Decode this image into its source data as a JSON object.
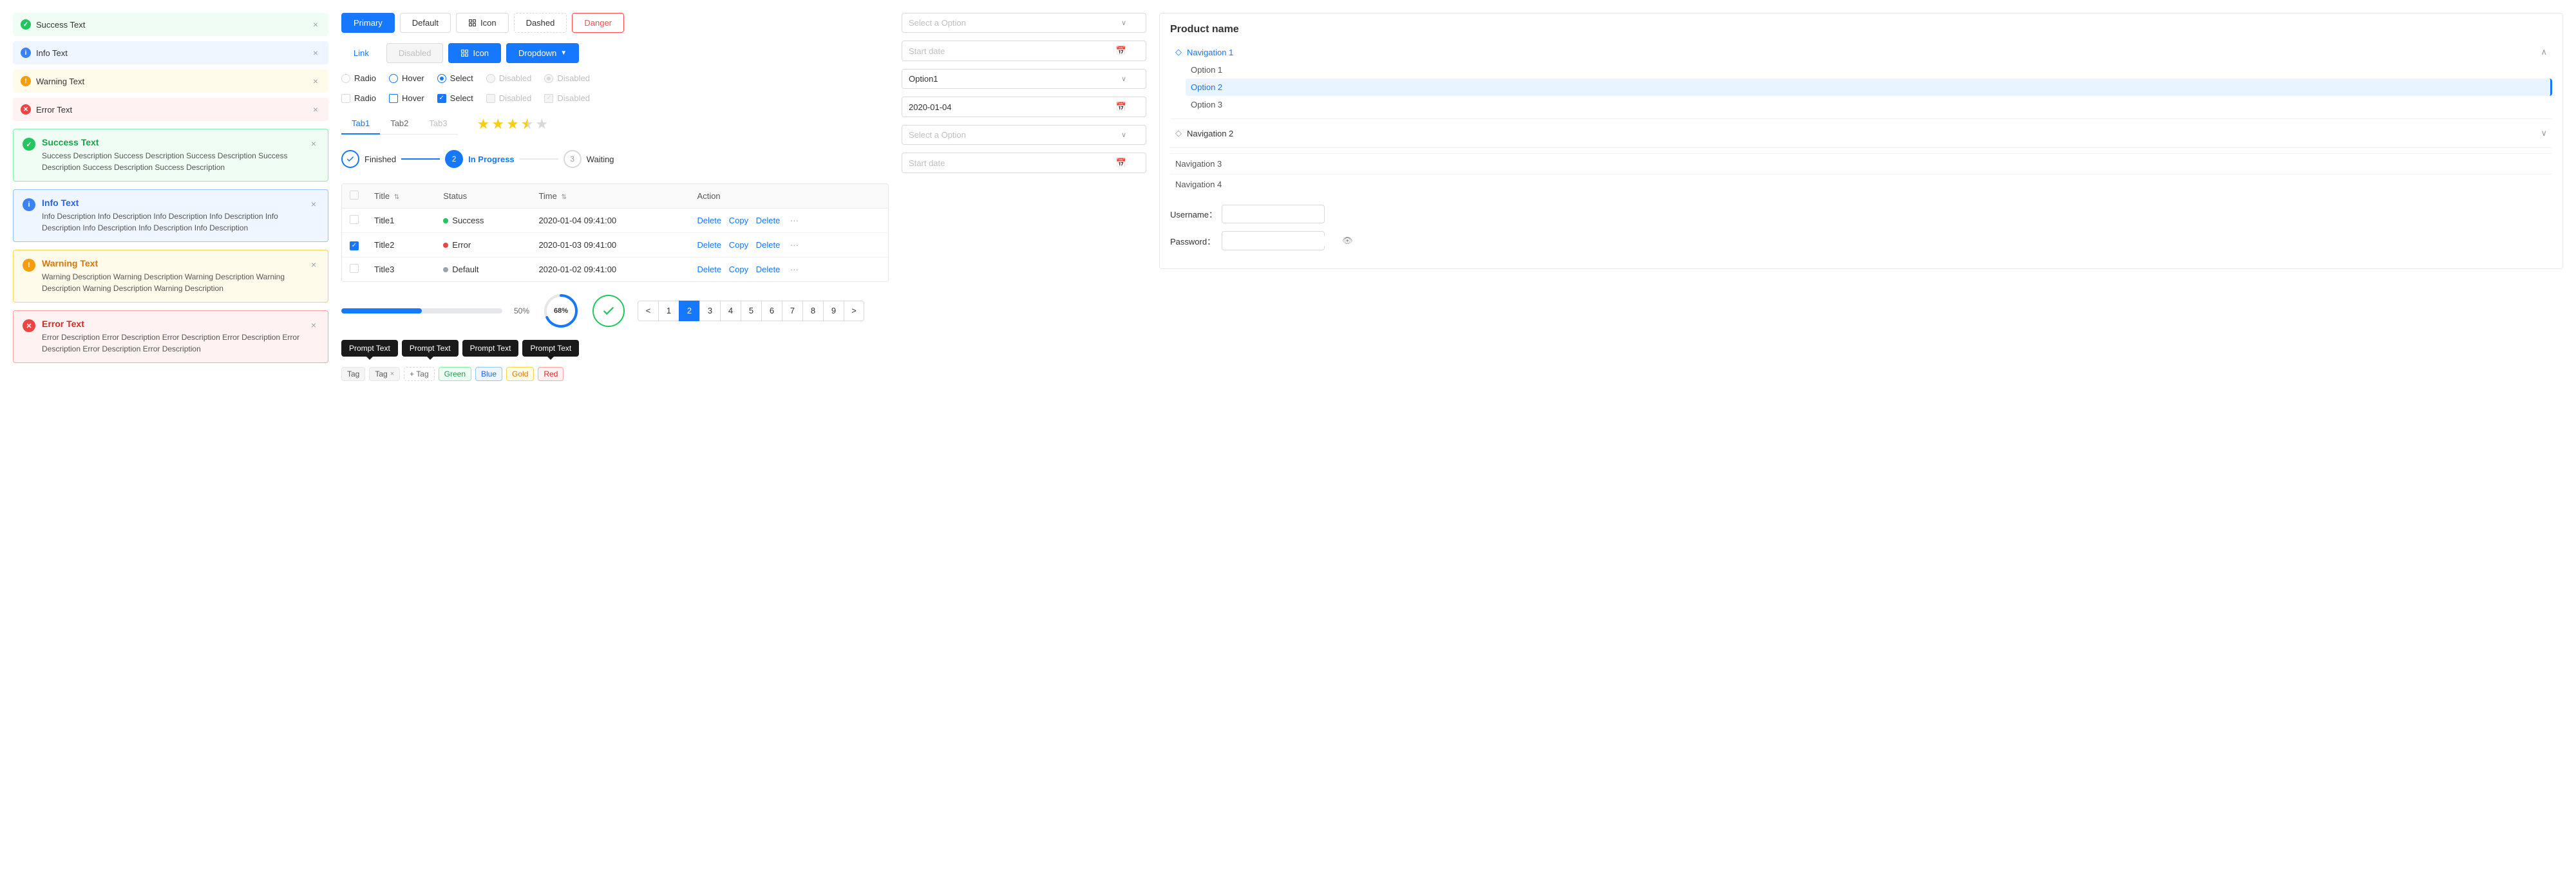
{
  "alerts": {
    "simple": [
      {
        "type": "success",
        "text": "Success Text",
        "icon": "✓"
      },
      {
        "type": "info",
        "text": "Info Text",
        "icon": "i"
      },
      {
        "type": "warning",
        "text": "Warning Text",
        "icon": "!"
      },
      {
        "type": "error",
        "text": "Error Text",
        "icon": "✕"
      }
    ],
    "detailed": [
      {
        "type": "success",
        "title": "Success Text",
        "icon": "✓",
        "desc": "Success Description Success Description Success Description Success Description Success Description Success Description"
      },
      {
        "type": "info",
        "title": "Info Text",
        "icon": "i",
        "desc": "Info Description Info Description Info Description Info Description Info Description Info Description Info Description Info Description"
      },
      {
        "type": "warning",
        "title": "Warning Text",
        "icon": "!",
        "desc": "Warning Description Warning Description Warning Description Warning Description Warning Description Warning Description"
      },
      {
        "type": "error",
        "title": "Error Text",
        "icon": "✕",
        "desc": "Error Description Error Description Error Description Error Description Error Description Error Description Error Description"
      }
    ]
  },
  "buttons": {
    "primary": "Primary",
    "default": "Default",
    "icon": "Icon",
    "dashed": "Dashed",
    "danger": "Danger",
    "link": "Link",
    "disabled": "Disabled",
    "icon_blue": "Icon",
    "dropdown": "Dropdown"
  },
  "controls": {
    "row1": [
      {
        "label": "Radio",
        "type": "radio",
        "state": "unchecked"
      },
      {
        "label": "Hover",
        "type": "radio",
        "state": "hover"
      },
      {
        "label": "Select",
        "type": "radio",
        "state": "selected"
      },
      {
        "label": "Disabled",
        "type": "radio",
        "state": "disabled"
      },
      {
        "label": "Disabled",
        "type": "radio",
        "state": "disabled-checked"
      }
    ],
    "row2": [
      {
        "label": "Radio",
        "type": "checkbox",
        "state": "unchecked"
      },
      {
        "label": "Hover",
        "type": "checkbox",
        "state": "hover"
      },
      {
        "label": "Select",
        "type": "checkbox",
        "state": "selected"
      },
      {
        "label": "Disabled",
        "type": "checkbox",
        "state": "disabled"
      },
      {
        "label": "Disabled",
        "type": "checkbox",
        "state": "disabled-checked"
      }
    ]
  },
  "tabs": {
    "items": [
      "Tab1",
      "Tab2",
      "Tab3"
    ],
    "active": 0
  },
  "stars": {
    "filled": 3,
    "half": 1,
    "empty": 1,
    "total": 5
  },
  "steps": [
    {
      "label": "Finished",
      "state": "done",
      "num": "✓"
    },
    {
      "label": "In Progress",
      "state": "active",
      "num": "2"
    },
    {
      "label": "Waiting",
      "state": "wait",
      "num": "3"
    }
  ],
  "table": {
    "headers": [
      "Title",
      "Status",
      "Time",
      "Action"
    ],
    "rows": [
      {
        "title": "Title1",
        "status": "Success",
        "statusType": "success",
        "time": "2020-01-04  09:41:00",
        "actions": [
          "Delete",
          "Copy",
          "Delete",
          "···"
        ]
      },
      {
        "title": "Title2",
        "status": "Error",
        "statusType": "error",
        "time": "2020-01-03  09:41:00",
        "actions": [
          "Delete",
          "Copy",
          "Delete",
          "···"
        ],
        "checked": true
      },
      {
        "title": "Title3",
        "status": "Default",
        "statusType": "default",
        "time": "2020-01-02  09:41:00",
        "actions": [
          "Delete",
          "Copy",
          "Delete",
          "···"
        ]
      }
    ]
  },
  "pagination": {
    "pages": [
      1,
      2,
      3,
      4,
      5,
      6,
      7,
      8,
      9
    ],
    "active": 2
  },
  "progress": {
    "bar_percent": 50,
    "bar_label": "50%",
    "circle_percent": 68,
    "circle_label": "68%"
  },
  "tooltips": [
    {
      "text": "Prompt Text",
      "dir": "down"
    },
    {
      "text": "Prompt Text",
      "dir": "down"
    },
    {
      "text": "Prompt Text",
      "dir": "up"
    },
    {
      "text": "Prompt Text",
      "dir": "down"
    }
  ],
  "selects": [
    {
      "placeholder": "Select a Option",
      "value": null
    },
    {
      "placeholder": "",
      "value": "Option1"
    },
    {
      "placeholder": "Select a Option",
      "value": null
    }
  ],
  "dates": [
    {
      "placeholder": "Start date",
      "value": null
    },
    {
      "placeholder": "",
      "value": "2020-01-04"
    },
    {
      "placeholder": "Start date",
      "value": null
    }
  ],
  "navigation": {
    "product_name": "Product name",
    "sections": [
      {
        "label": "Navigation 1",
        "icon": "◇",
        "expanded": true,
        "items": [
          "Option 1",
          "Option 2",
          "Option 3"
        ],
        "active_item": "Option 2"
      },
      {
        "label": "Navigation 2",
        "icon": "◇",
        "expanded": false,
        "items": []
      }
    ],
    "plain_sections": [
      "Navigation 3",
      "Navigation 4"
    ]
  },
  "form": {
    "username_label": "Username：",
    "password_label": "Password：",
    "username_value": "",
    "password_value": ""
  },
  "tags": {
    "items": [
      "Tag",
      "Tag"
    ],
    "add_label": "+ Tag",
    "colored": [
      "Green",
      "Blue",
      "Gold",
      "Red"
    ]
  }
}
